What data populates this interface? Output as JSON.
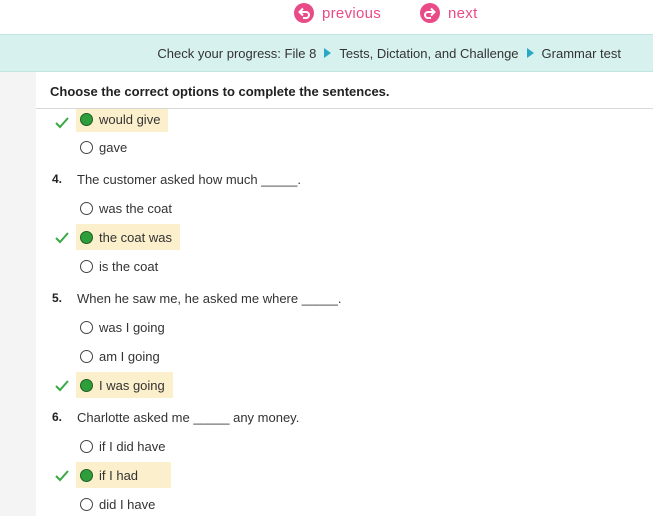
{
  "nav": {
    "previous_label": "previous",
    "next_label": "next"
  },
  "breadcrumb": {
    "items": [
      "Check your progress: File 8",
      "Tests, Dictation, and Challenge",
      "Grammar test"
    ]
  },
  "instructions": "Choose the correct options to complete the sentences.",
  "questions": [
    {
      "number": "",
      "text": "",
      "options": [
        {
          "label": "would give",
          "selected": true,
          "correct": true
        },
        {
          "label": "gave",
          "selected": false,
          "correct": false
        }
      ]
    },
    {
      "number": "4.",
      "text": "The customer asked how much _____.",
      "options": [
        {
          "label": "was the coat",
          "selected": false,
          "correct": false
        },
        {
          "label": "the coat was",
          "selected": true,
          "correct": true
        },
        {
          "label": "is the coat",
          "selected": false,
          "correct": false
        }
      ]
    },
    {
      "number": "5.",
      "text": "When he saw me, he asked me where _____.",
      "options": [
        {
          "label": "was I going",
          "selected": false,
          "correct": false
        },
        {
          "label": "am I going",
          "selected": false,
          "correct": false
        },
        {
          "label": "I was going",
          "selected": true,
          "correct": true
        }
      ]
    },
    {
      "number": "6.",
      "text": "Charlotte asked me _____ any money.",
      "options": [
        {
          "label": "if I did have",
          "selected": false,
          "correct": false
        },
        {
          "label": "if I had",
          "selected": true,
          "correct": true
        },
        {
          "label": "did I have",
          "selected": false,
          "correct": false
        }
      ]
    }
  ],
  "colors": {
    "accent": "#e94b86",
    "correct": "#2e9e3a",
    "highlight": "#fcefcc",
    "banner": "#d7f1ef",
    "arrow": "#2aa8c6"
  }
}
